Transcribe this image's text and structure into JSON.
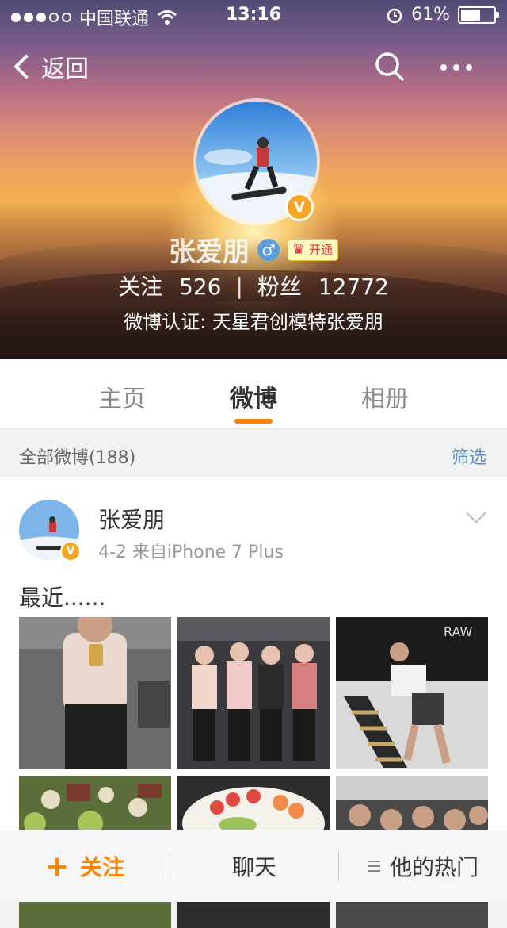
{
  "status_bar": {
    "carrier": "中国联通",
    "time": "13:16",
    "battery": "61%",
    "battery_level": 0.61
  },
  "nav": {
    "back_label": "返回"
  },
  "profile": {
    "name": "张爱朋",
    "vip_label": "开通",
    "following_label": "关注",
    "following_count": "526",
    "separator": "|",
    "followers_label": "粉丝",
    "followers_count": "12772",
    "verification": "微博认证: 天星君创模特张爱朋"
  },
  "tabs": [
    {
      "label": "主页"
    },
    {
      "label": "微博"
    },
    {
      "label": "相册"
    }
  ],
  "filter_bar": {
    "count_label": "全部微博(188)",
    "filter_label": "筛选"
  },
  "post": {
    "author": "张爱朋",
    "meta": "4-2  来自iPhone 7 Plus",
    "text": "最近......"
  },
  "bottom_bar": {
    "follow_plus": "+",
    "follow_label": "关注",
    "chat_label": "聊天",
    "hot_label": "他的热门"
  },
  "colors": {
    "accent": "#ff8200",
    "link": "#5b8fbf",
    "verified": "#f5a623"
  }
}
